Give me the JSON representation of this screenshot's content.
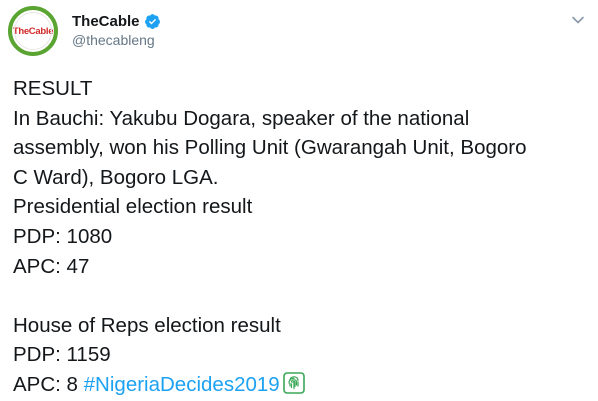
{
  "account": {
    "avatar_text": "TheCable",
    "display_name": "TheCable",
    "handle": "@thecableng",
    "verified_icon": "verified-badge-icon"
  },
  "tweet": {
    "line1": "RESULT",
    "line2": "In Bauchi: Yakubu Dogara, speaker of the national",
    "line3": "assembly, won his Polling Unit (Gwarangah Unit, Bogoro",
    "line4": "C Ward), Bogoro LGA.",
    "line5": "Presidential election result",
    "line6": "PDP: 1080",
    "line7": "APC: 47",
    "line8": "House of Reps election result",
    "line9": "PDP: 1159",
    "line10_prefix": "APC: 8",
    "hashtag": "#NigeriaDecides2019",
    "hashtag_emoji": "fingerprint-emoji-icon"
  },
  "colors": {
    "text": "#14171a",
    "secondary": "#657786",
    "link": "#1da1f2",
    "verified": "#1da1f2",
    "avatar_ring": "#5aa532",
    "avatar_text": "#d12a2a"
  }
}
